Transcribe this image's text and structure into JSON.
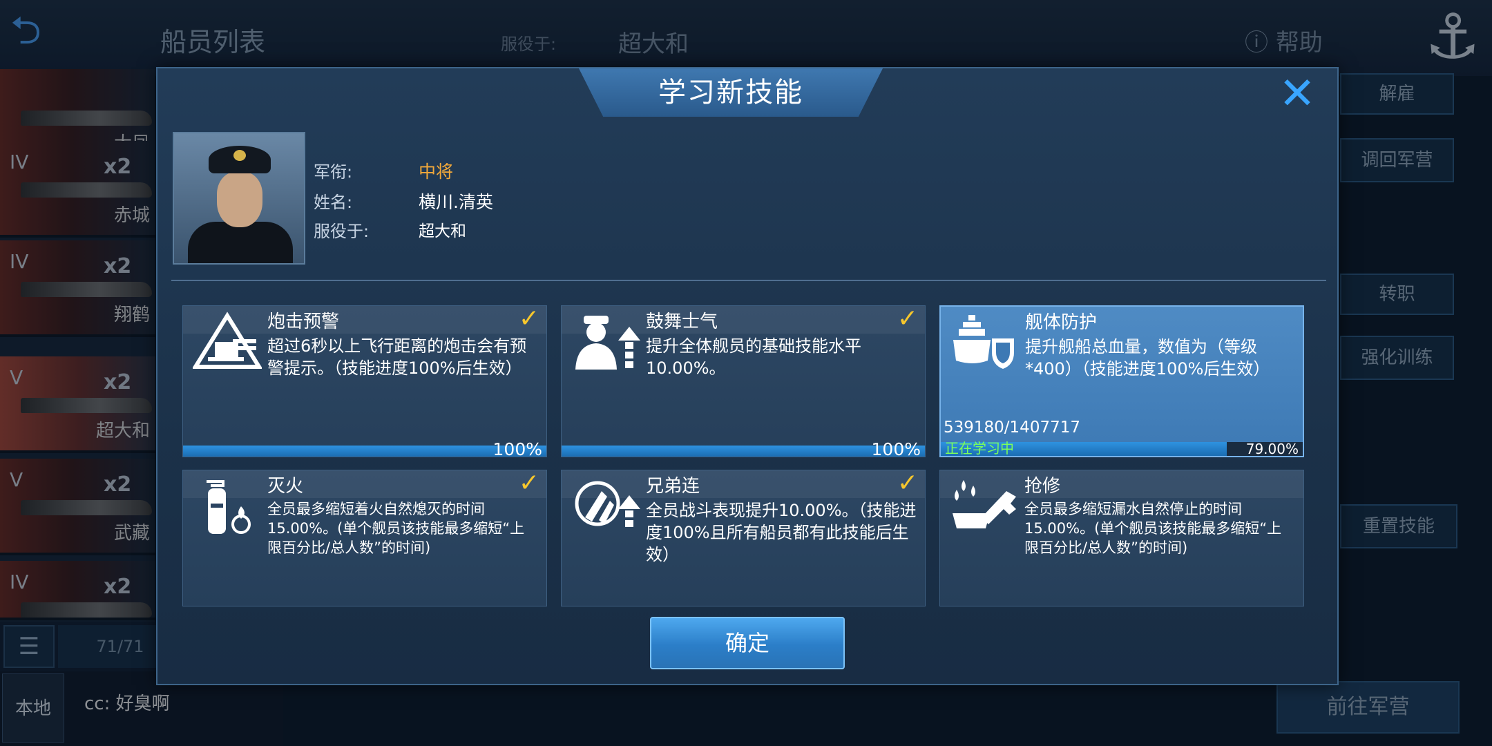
{
  "background": {
    "title": "船员列表",
    "serve_label": "服役于:",
    "serve_ship": "超大和",
    "help_label": "帮助",
    "ships": [
      {
        "tier": "",
        "count": "",
        "name": "大凤"
      },
      {
        "tier": "IV",
        "count": "x2",
        "name": "赤城"
      },
      {
        "tier": "IV",
        "count": "x2",
        "name": "翔鹤"
      },
      {
        "tier": "V",
        "count": "x2",
        "name": "超大和"
      },
      {
        "tier": "V",
        "count": "x2",
        "name": "武藏"
      },
      {
        "tier": "IV",
        "count": "x2",
        "name": ""
      }
    ],
    "right_buttons": [
      "解雇",
      "调回军营",
      "转职",
      "强化训练",
      "重置技能"
    ],
    "crew_count": "71/71",
    "chat": {
      "tab_label": "本地",
      "message": "cc: 好臭啊"
    },
    "go_camp_button": "前往军营"
  },
  "dialog": {
    "title": "学习新技能",
    "officer": {
      "rank_label": "军衔:",
      "rank_value": "中将",
      "name_label": "姓名:",
      "name_value": "横川.清英",
      "serve_label": "服役于:",
      "serve_value": "超大和"
    },
    "skills": [
      {
        "name": "炮击预警",
        "icon": "artillery-warning-icon",
        "desc": "超过6秒以上飞行距离的炮击会有预警提示。（技能进度100%后生效）",
        "learned": true,
        "progress": 1.0,
        "progress_text": "100%"
      },
      {
        "name": "鼓舞士气",
        "icon": "morale-boost-icon",
        "desc": "提升全体舰员的基础技能水平10.00%。",
        "learned": true,
        "progress": 1.0,
        "progress_text": "100%"
      },
      {
        "name": "舰体防护",
        "icon": "hull-protection-icon",
        "desc": "提升舰船总血量，数值为（等级*400）（技能进度100%后生效）",
        "learned": false,
        "progress": 0.79,
        "progress_count": "539180/1407717",
        "status": "正在学习中",
        "progress_text": "79.00%"
      },
      {
        "name": "灭火",
        "icon": "fire-extinguisher-icon",
        "desc": "全员最多缩短着火自然熄灭的时间15.00%。(单个舰员该技能最多缩短“上限百分比/总人数”的时间)",
        "learned": true
      },
      {
        "name": "兄弟连",
        "icon": "brotherhood-icon",
        "desc": "全员战斗表现提升10.00%。（技能进度100%且所有船员都有此技能后生效）",
        "learned": true
      },
      {
        "name": "抢修",
        "icon": "repair-icon",
        "desc": "全员最多缩短漏水自然停止的时间15.00%。(单个舰员该技能最多缩短“上限百分比/总人数”的时间)",
        "learned": false
      }
    ],
    "confirm_label": "确定"
  },
  "colors": {
    "accent": "#39a5ff",
    "rank": "#f2a93a",
    "check": "#f7c72c",
    "learning": "#7dff5a"
  }
}
